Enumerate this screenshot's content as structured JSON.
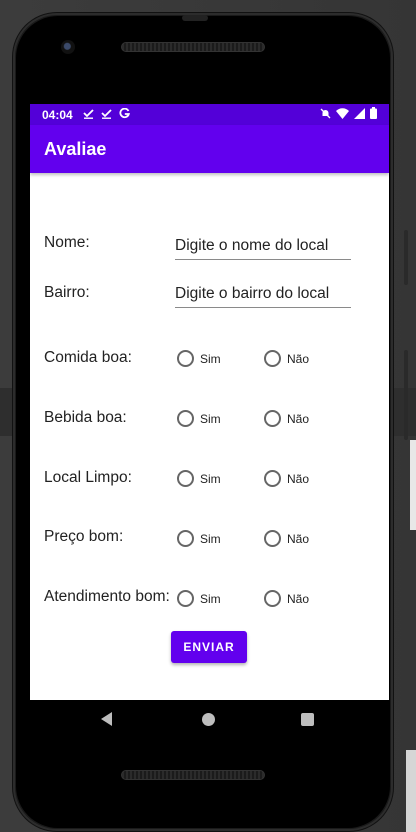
{
  "status_bar": {
    "time": "04:04",
    "left_icons": [
      "download-done-icon",
      "download-done-icon",
      "google-g-icon"
    ],
    "right_icons": [
      "notifications-off-icon",
      "wifi-icon",
      "signal-icon",
      "battery-icon"
    ]
  },
  "app_bar": {
    "title": "Avaliae"
  },
  "form": {
    "name": {
      "label": "Nome:",
      "placeholder": "Digite o nome do local"
    },
    "neighborhood": {
      "label": "Bairro:",
      "placeholder": "Digite o bairro do local"
    },
    "questions": [
      {
        "label": "Comida boa:",
        "yes": "Sim",
        "no": "Não"
      },
      {
        "label": "Bebida boa:",
        "yes": "Sim",
        "no": "Não"
      },
      {
        "label": "Local Limpo:",
        "yes": "Sim",
        "no": "Não"
      },
      {
        "label": "Preço bom:",
        "yes": "Sim",
        "no": "Não"
      },
      {
        "label": "Atendimento bom:",
        "yes": "Sim",
        "no": "Não"
      }
    ],
    "submit_label": "ENVIAR"
  },
  "colors": {
    "primary": "#6200ee",
    "status_bar": "#5300d8"
  }
}
